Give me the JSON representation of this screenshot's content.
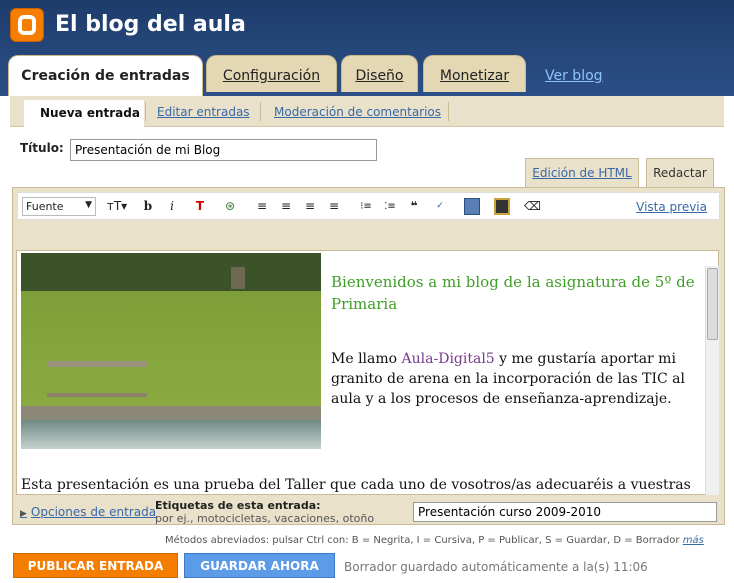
{
  "header": {
    "title": "El blog del aula",
    "brand_color": "#f57d00"
  },
  "tabs": [
    {
      "label": "Creación de entradas"
    },
    {
      "label": "Configuración"
    },
    {
      "label": "Diseño"
    },
    {
      "label": "Monetizar"
    },
    {
      "label": "Ver blog"
    }
  ],
  "subtabs": [
    {
      "label": "Nueva entrada"
    },
    {
      "label": "Editar entradas"
    },
    {
      "label": "Moderación de comentarios"
    }
  ],
  "post": {
    "title_label": "Título:",
    "title_value": "Presentación de mi Blog"
  },
  "modes": {
    "html": "Edición de HTML",
    "compose": "Redactar"
  },
  "toolbar": {
    "font_label": "Fuente",
    "preview": "Vista previa"
  },
  "content": {
    "heading": "Bienvenidos a mi blog de la asignatura de 5º de Primaria",
    "para1_before": "Me llamo ",
    "para1_link": "Aula-Digital5",
    "para1_after": " y me gustaría aportar mi granito de arena en la incorporación de las TIC al aula y a los procesos de enseñanza-aprendizaje.",
    "para2": "Esta presentación es una prueba del Taller que cada uno de vosotros/as adecuaréis a vuestras"
  },
  "footer": {
    "options": "Opciones de entrada",
    "tags_label": "Etiquetas de esta entrada:",
    "tags_hint": "por ej., motocicletas, vacaciones, otoño",
    "tags_value": "Presentación curso 2009-2010",
    "shortcuts": "Métodos abreviados: pulsar Ctrl con: B = Negrita, I = Cursiva, P = Publicar, S = Guardar, D = Borrador",
    "more": "más",
    "publish": "PUBLICAR ENTRADA",
    "save": "GUARDAR AHORA",
    "status": "Borrador guardado automáticamente a la(s) 11:06"
  }
}
